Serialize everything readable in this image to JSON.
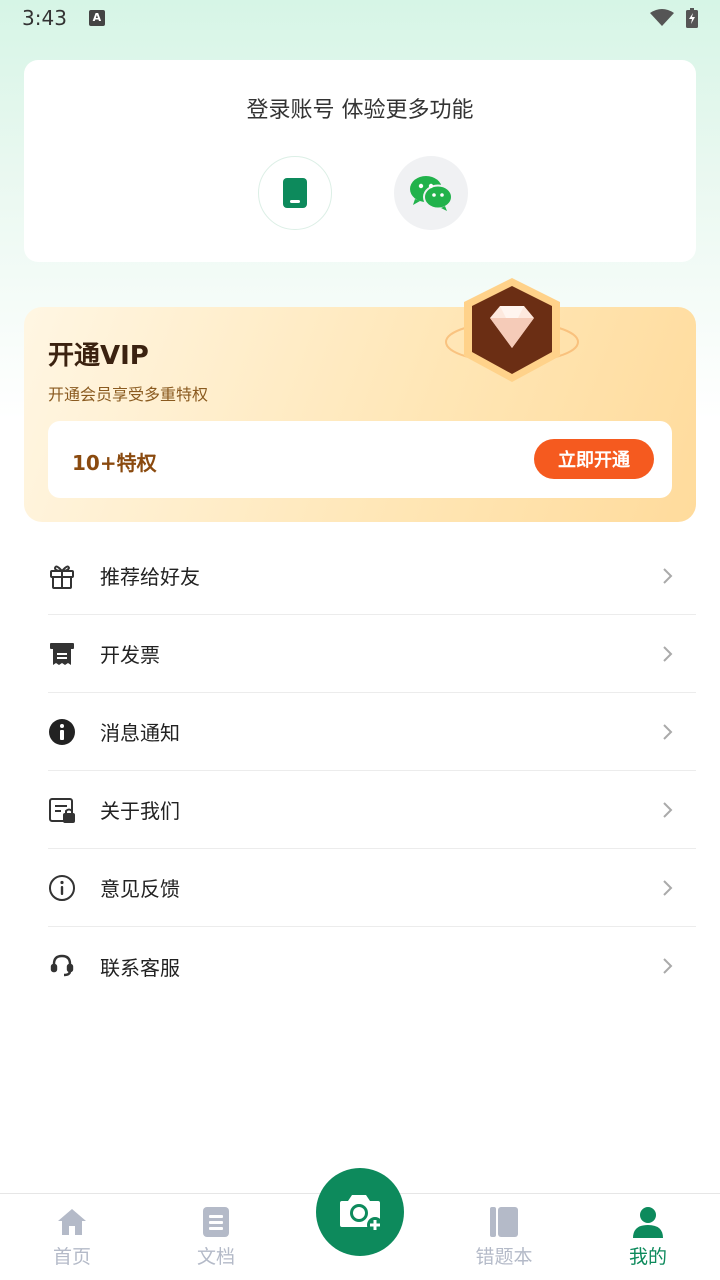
{
  "status_bar": {
    "time": "3:43",
    "notification_badge": "A"
  },
  "login": {
    "title": "登录账号 体验更多功能",
    "phone_icon": "phone-icon",
    "wechat_icon": "wechat-icon"
  },
  "vip": {
    "title": "开通VIP",
    "subtitle": "开通会员享受多重特权",
    "privilege_count": "10+特权",
    "open_button": "立即开通"
  },
  "menu": {
    "items": [
      {
        "label": "推荐给好友",
        "icon": "gift-icon"
      },
      {
        "label": "开发票",
        "icon": "invoice-icon"
      },
      {
        "label": "消息通知",
        "icon": "info-icon"
      },
      {
        "label": "关于我们",
        "icon": "about-icon"
      },
      {
        "label": "意见反馈",
        "icon": "feedback-icon"
      },
      {
        "label": "联系客服",
        "icon": "headset-icon"
      }
    ]
  },
  "bottom_nav": {
    "items": [
      {
        "label": "首页",
        "icon": "home-icon"
      },
      {
        "label": "文档",
        "icon": "document-icon"
      },
      {
        "label": "错题本",
        "icon": "notebook-icon"
      },
      {
        "label": "我的",
        "icon": "user-icon",
        "active": true
      }
    ],
    "camera_icon": "camera-plus-icon"
  },
  "colors": {
    "primary": "#0d8a5c",
    "vip_button": "#f55a1f",
    "nav_inactive": "#b4bac8"
  }
}
